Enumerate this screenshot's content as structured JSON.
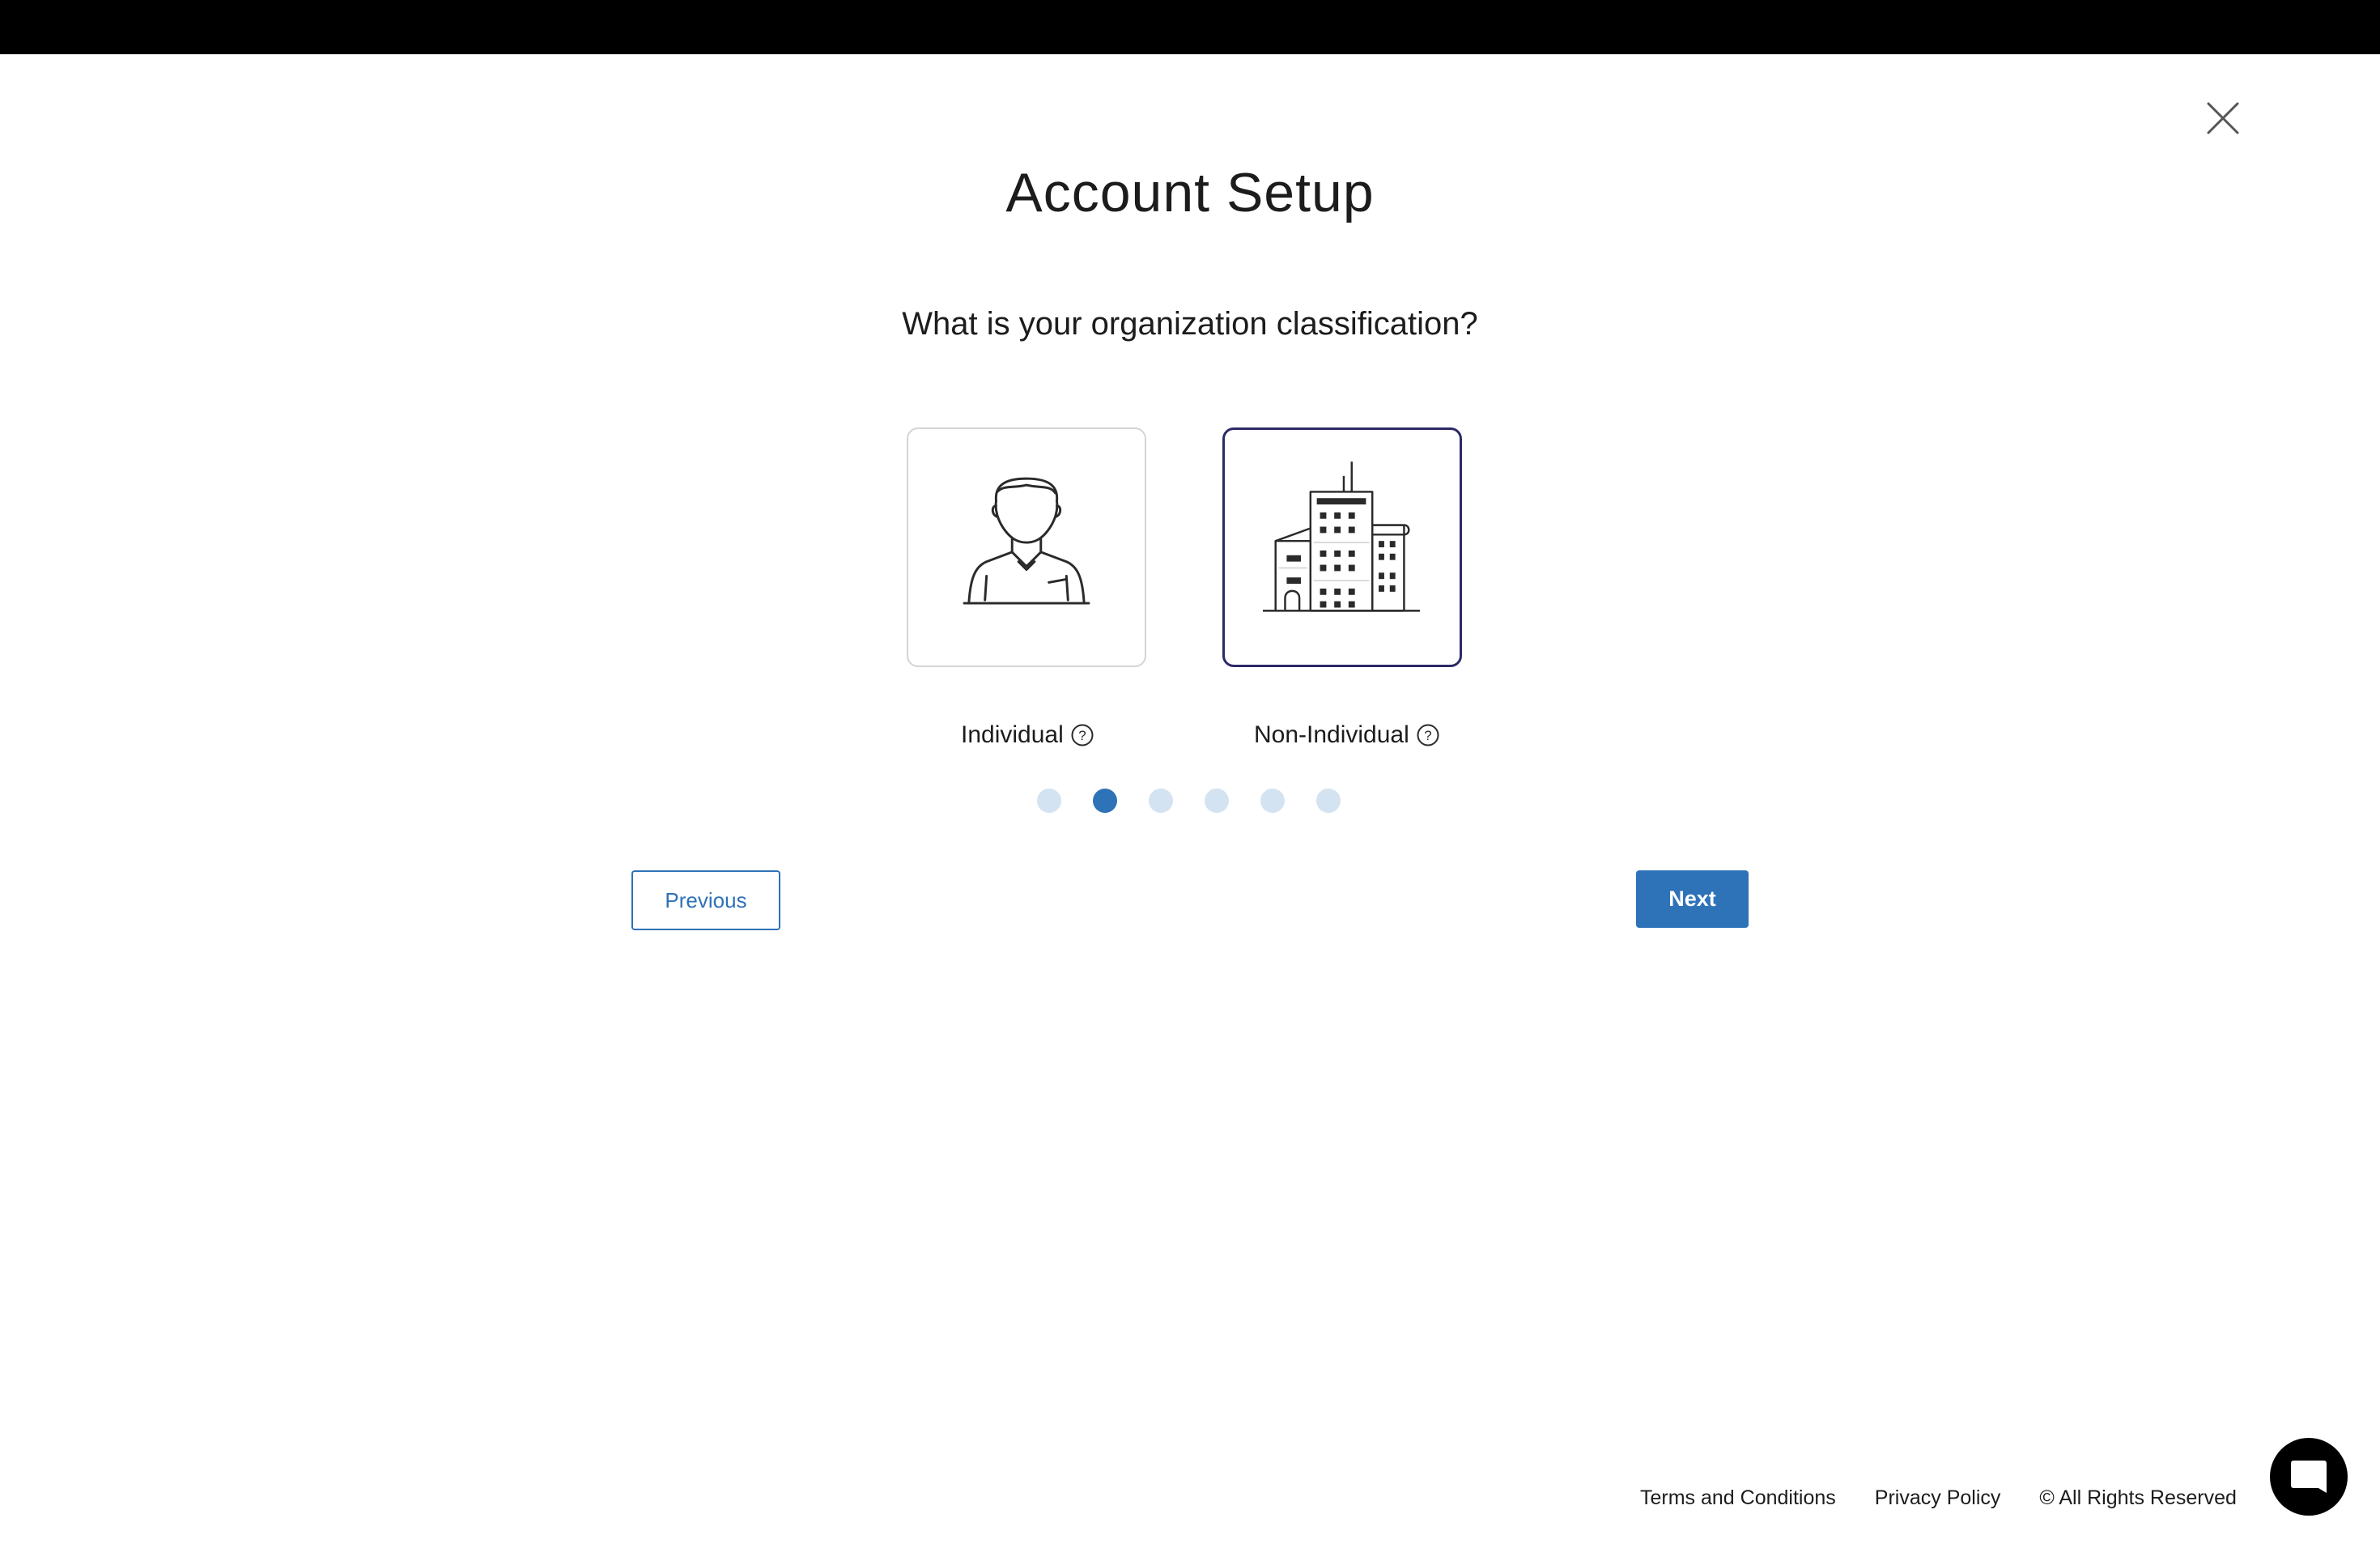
{
  "header": {
    "title": "Account Setup"
  },
  "wizard": {
    "question": "What is your organization classification?",
    "options": [
      {
        "label": "Individual",
        "icon": "person-icon",
        "selected": false
      },
      {
        "label": "Non-Individual",
        "icon": "building-icon",
        "selected": true
      }
    ],
    "steps_total": 6,
    "current_step": 2,
    "previous_label": "Previous",
    "next_label": "Next"
  },
  "footer": {
    "terms": "Terms and Conditions",
    "privacy": "Privacy Policy",
    "rights": "© All Rights Reserved"
  },
  "colors": {
    "primary": "#2e72b8",
    "selected_border": "#2c2a66",
    "dot_inactive": "#d3e3f1"
  }
}
